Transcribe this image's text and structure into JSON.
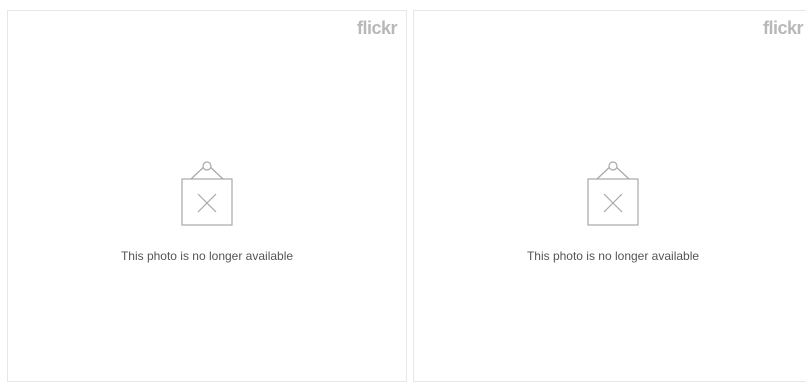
{
  "panels": [
    {
      "brand": "flickr",
      "icon": "missing-photo-icon",
      "message": "This photo is no longer available"
    },
    {
      "brand": "flickr",
      "icon": "missing-photo-icon",
      "message": "This photo is no longer available"
    }
  ],
  "colors": {
    "brand": "#b8b8b8",
    "icon_stroke": "#a8a8a8",
    "message": "#555555",
    "border": "#e6e6e6"
  }
}
